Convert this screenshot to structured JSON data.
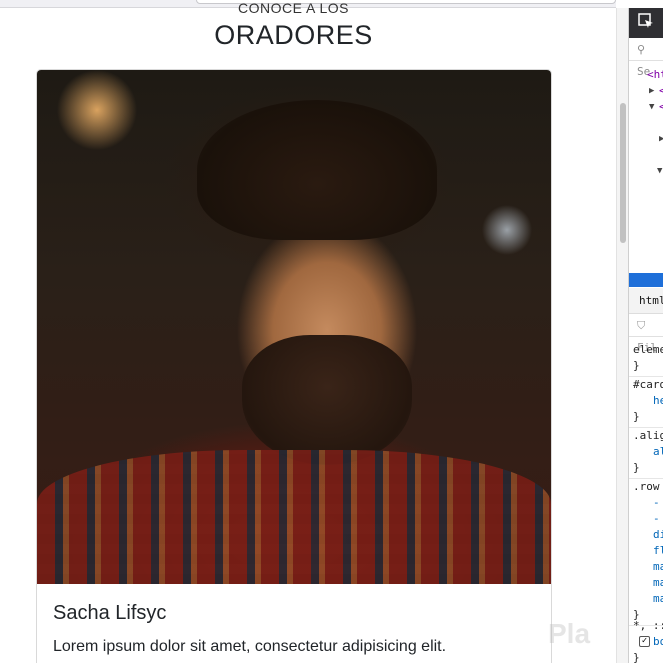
{
  "section": {
    "eyebrow": "CONOCE A LOS",
    "heading": "ORADORES"
  },
  "card": {
    "name": "Sacha Lifsyc",
    "text_line1": "Lorem ipsum dolor sit amet, consectetur adipisicing elit.",
    "photo_alt": "Portrait of smiling bearded man in plaid shirt"
  },
  "watermark": "Pla",
  "devtools": {
    "picker_icon": "element-picker-icon",
    "search_placeholder": "Se",
    "tree": [
      "<ht",
      "<",
      "<"
    ],
    "tab_html": "html",
    "filter_placeholder": "Fil",
    "rules": [
      {
        "selector": "eleme",
        "props": []
      },
      {
        "selector": "#card",
        "props": [
          "he"
        ]
      },
      {
        "selector": ".alig",
        "props": [
          "al"
        ]
      },
      {
        "selector": ".row",
        "props": [
          "-",
          "-",
          "di",
          "fl",
          "ma",
          "ma",
          "ma"
        ]
      },
      {
        "selector": "*, ::",
        "props": [
          "bo"
        ]
      }
    ]
  },
  "colors": {
    "heading": "#212529",
    "devtools_toolbar": "#2f2f33",
    "selection": "#1e6fd9",
    "selector_purple": "#8000a8",
    "property_blue": "#0066b8"
  }
}
